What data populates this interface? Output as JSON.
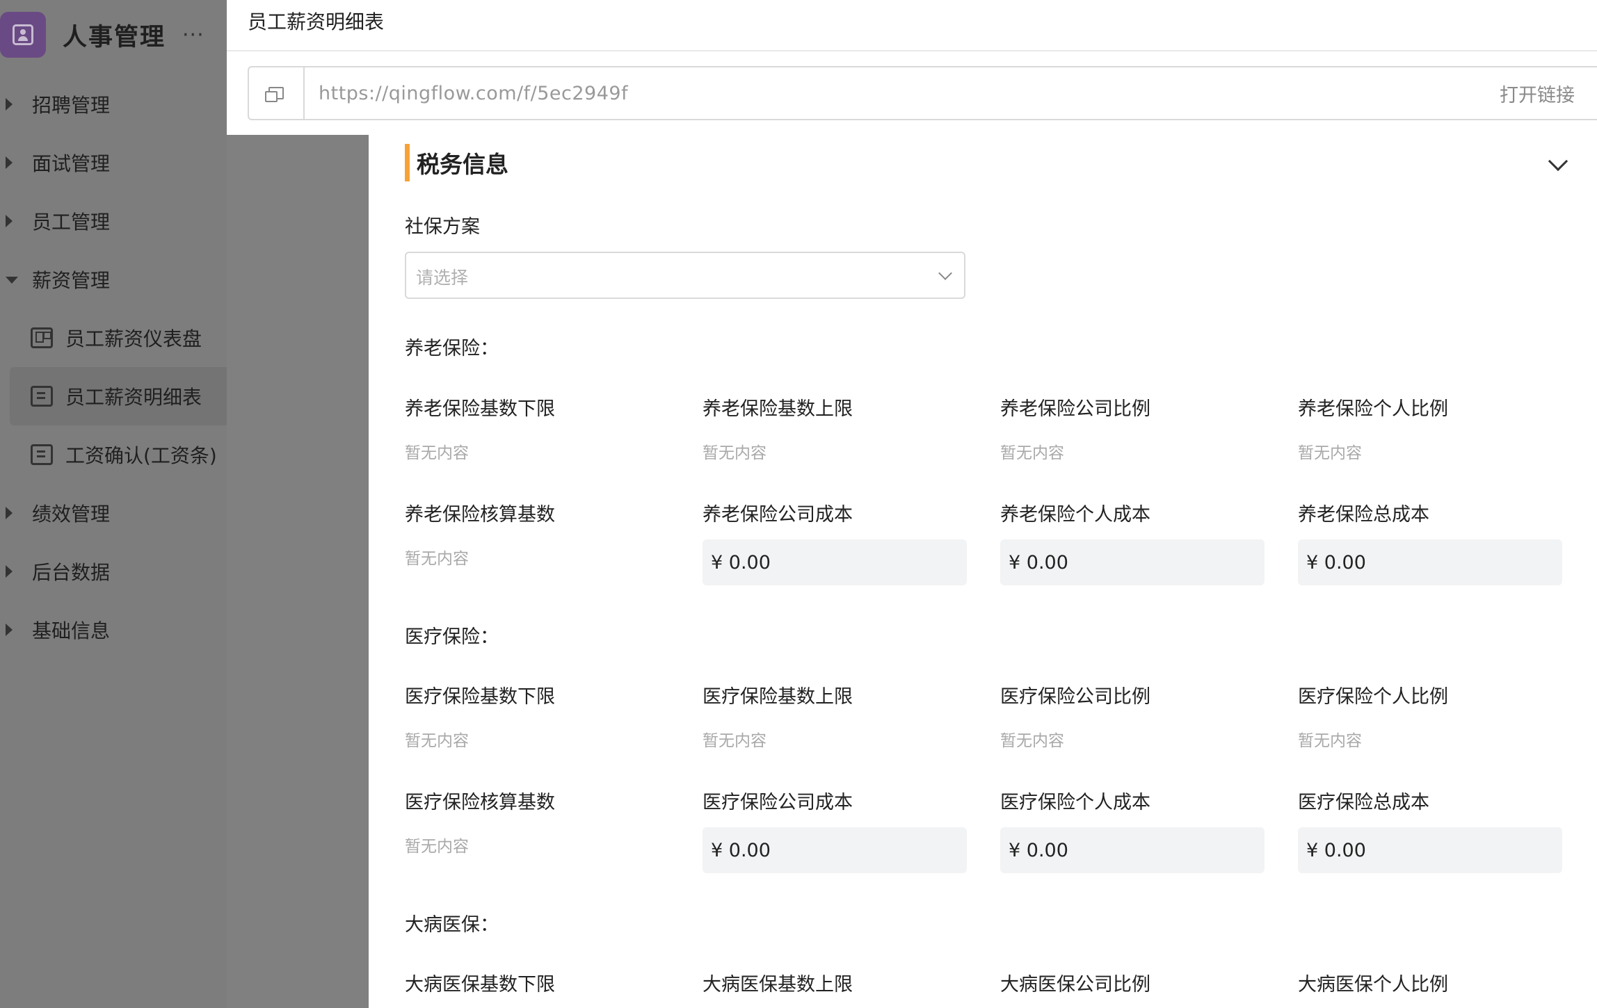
{
  "app": {
    "title": "人事管理",
    "more": "···"
  },
  "nav": {
    "items": [
      {
        "label": "招聘管理"
      },
      {
        "label": "面试管理"
      },
      {
        "label": "员工管理"
      },
      {
        "label": "薪资管理"
      }
    ],
    "sub": [
      {
        "label": "员工薪资仪表盘"
      },
      {
        "label": "员工薪资明细表"
      },
      {
        "label": "工资确认(工资条)"
      }
    ],
    "items_after": [
      {
        "label": "绩效管理"
      },
      {
        "label": "后台数据"
      },
      {
        "label": "基础信息"
      }
    ]
  },
  "page": {
    "title": "员工薪资明细表"
  },
  "link": {
    "url": "https://qingflow.com/f/5ec2949f",
    "open": "打开链接",
    "copy": "复"
  },
  "section": {
    "title": "税务信息"
  },
  "social": {
    "label": "社保方案",
    "placeholder": "请选择"
  },
  "empty_text": "暂无内容",
  "pension": {
    "group": "养老保险：",
    "base_min": "养老保险基数下限",
    "base_max": "养老保险基数上限",
    "company_ratio": "养老保险公司比例",
    "personal_ratio": "养老保险个人比例",
    "calc_base": "养老保险核算基数",
    "company_cost": "养老保险公司成本",
    "personal_cost": "养老保险个人成本",
    "total_cost": "养老保险总成本",
    "company_cost_value": "¥ 0.00",
    "personal_cost_value": "¥ 0.00",
    "total_cost_value": "¥ 0.00"
  },
  "medical": {
    "group": "医疗保险：",
    "base_min": "医疗保险基数下限",
    "base_max": "医疗保险基数上限",
    "company_ratio": "医疗保险公司比例",
    "personal_ratio": "医疗保险个人比例",
    "calc_base": "医疗保险核算基数",
    "company_cost": "医疗保险公司成本",
    "personal_cost": "医疗保险个人成本",
    "total_cost": "医疗保险总成本",
    "company_cost_value": "¥ 0.00",
    "personal_cost_value": "¥ 0.00",
    "total_cost_value": "¥ 0.00"
  },
  "critical": {
    "group": "大病医保：",
    "base_min": "大病医保基数下限",
    "base_max": "大病医保基数上限",
    "company_ratio": "大病医保公司比例",
    "personal_ratio": "大病医保个人比例"
  }
}
